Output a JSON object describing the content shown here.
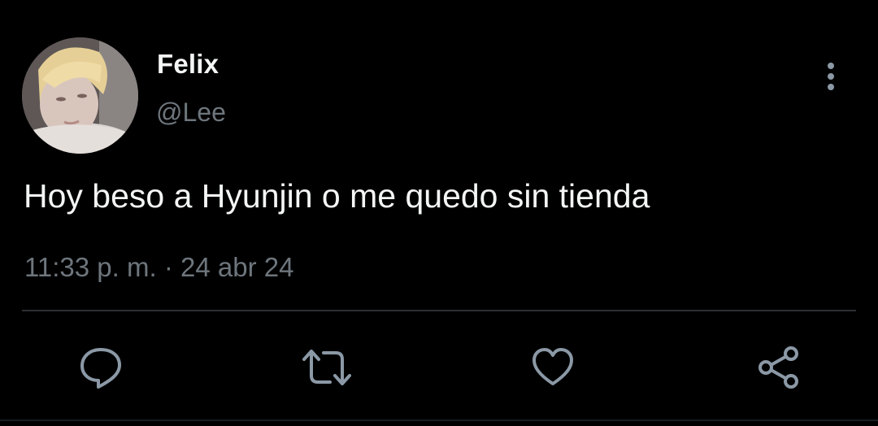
{
  "author": {
    "display_name": "Felix",
    "handle": "@Lee",
    "avatar_icon": "profile-photo"
  },
  "tweet": {
    "text": "Hoy beso a Hyunjin o me quedo sin tienda",
    "time": "11:33 p. m.",
    "separator": "·",
    "date": "24 abr 24"
  },
  "actions": [
    {
      "name": "reply",
      "icon": "comment-icon"
    },
    {
      "name": "retweet",
      "icon": "retweet-icon"
    },
    {
      "name": "like",
      "icon": "heart-icon"
    },
    {
      "name": "share",
      "icon": "share-icon"
    }
  ],
  "colors": {
    "background": "#000000",
    "primary_text": "#f4f5f5",
    "secondary_text": "#6e767d",
    "icon": "#8b98a5",
    "divider": "#2b2f33"
  }
}
